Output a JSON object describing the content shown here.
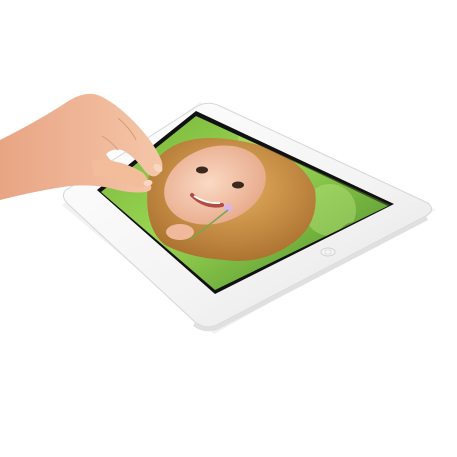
{
  "scene": {
    "subject": "tablet-with-hand",
    "colors": {
      "background": "#ffffff",
      "bezel": "#f4f4f4",
      "bezel_edge": "#d9d9d9",
      "screen_frame": "#111111",
      "photo_green_light": "#8fd14a",
      "photo_green_dark": "#3f7f1f",
      "hair": "#c98b3a",
      "skin": "#f2c4a8",
      "hand_skin": "#f0b592"
    },
    "icons": [
      "home-button-icon"
    ]
  }
}
